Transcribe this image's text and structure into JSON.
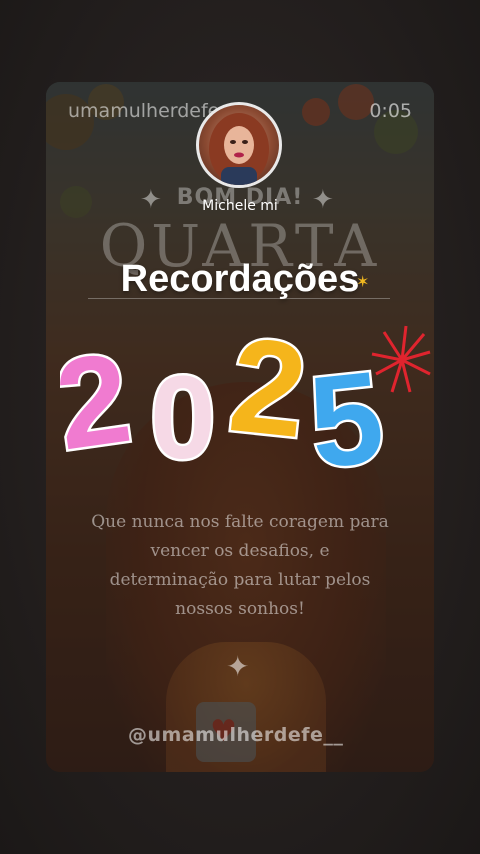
{
  "story": {
    "username": "umamulherdefe",
    "timer": "0:05",
    "profile_name": "Michele mi",
    "title": "Recordações",
    "year_digits": [
      "2",
      "0",
      "2",
      "5"
    ],
    "background_greeting": "BOM DIA!",
    "background_day": "QUARTA",
    "quote": "Que nunca nos falte coragem para vencer os desafios, e determinação para lutar pelos nossos sonhos!",
    "handle": "@umamulherdefe__"
  },
  "colors": {
    "digit_2a": "#f07bd0",
    "digit_0": "#f6d9e6",
    "digit_2b": "#f5b51b",
    "digit_5": "#3fa8ee",
    "firework": "#e0242e"
  },
  "icons": [
    "sparkle-icon",
    "star-icon",
    "firework-icon",
    "heart-icon"
  ]
}
